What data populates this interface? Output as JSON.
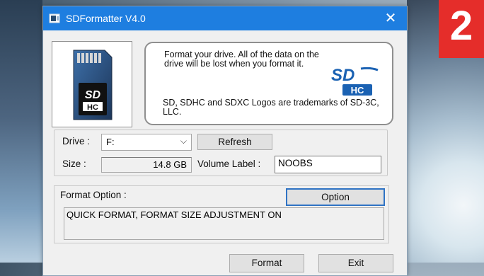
{
  "window": {
    "title": "SDFormatter V4.0",
    "close_glyph": "✕",
    "app_icon": "sdformatter-app-icon"
  },
  "badge": {
    "number": "2",
    "color": "#e52d2a"
  },
  "info": {
    "format_warning": "Format your drive. All of the data on the drive will be lost when you format it.",
    "trademark_notice": "SD, SDHC and SDXC Logos are trademarks of SD-3C, LLC.",
    "card_icon": "sdhc-card-icon",
    "logo_icon": "sdhc-logo-icon"
  },
  "drive": {
    "label": "Drive :",
    "selected": "F:",
    "chevron": "⌵",
    "refresh_label": "Refresh"
  },
  "size": {
    "label": "Size :",
    "value": "14.8 GB"
  },
  "volume": {
    "label": "Volume Label :",
    "value": "NOOBS"
  },
  "format_option": {
    "label": "Format Option :",
    "option_button": "Option",
    "summary": "QUICK FORMAT, FORMAT SIZE ADJUSTMENT ON"
  },
  "actions": {
    "format_label": "Format",
    "exit_label": "Exit"
  },
  "colors": {
    "titlebar": "#1e7ee0",
    "sdhc_blue": "#1b62b3"
  }
}
